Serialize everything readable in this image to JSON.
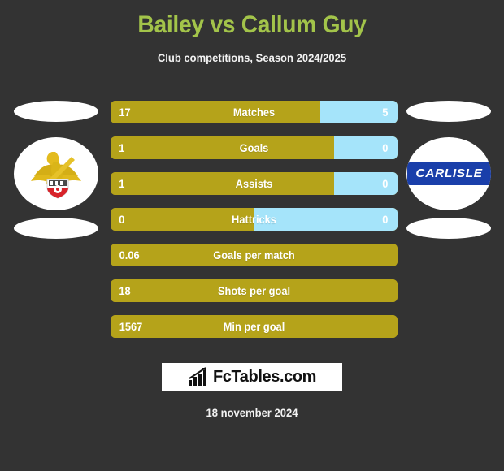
{
  "header": {
    "title": "Bailey vs Callum Guy",
    "subtitle": "Club competitions, Season 2024/2025"
  },
  "teams": {
    "left": {
      "name": "Doncaster Rovers",
      "badge_icon": "doncaster-rovers-badge"
    },
    "right": {
      "name": "CARLISLE",
      "badge_icon": "carlisle-united-badge"
    }
  },
  "stats": [
    {
      "label": "Matches",
      "left": "17",
      "right": "5",
      "left_pct": 73,
      "split": true
    },
    {
      "label": "Goals",
      "left": "1",
      "right": "0",
      "left_pct": 78,
      "split": true
    },
    {
      "label": "Assists",
      "left": "1",
      "right": "0",
      "left_pct": 78,
      "split": true
    },
    {
      "label": "Hattricks",
      "left": "0",
      "right": "0",
      "left_pct": 50,
      "split": true
    },
    {
      "label": "Goals per match",
      "left": "0.06",
      "right": "",
      "left_pct": 100,
      "split": false
    },
    {
      "label": "Shots per goal",
      "left": "18",
      "right": "",
      "left_pct": 100,
      "split": false
    },
    {
      "label": "Min per goal",
      "left": "1567",
      "right": "",
      "left_pct": 100,
      "split": false
    }
  ],
  "footer": {
    "brand": "FcTables.com",
    "brand_icon": "bar-chart-icon",
    "date": "18 november 2024"
  },
  "colors": {
    "background": "#333333",
    "title": "#a3c44a",
    "bar_left": "#b5a31a",
    "bar_right": "#a5e4fa",
    "text": "#ffffff"
  }
}
